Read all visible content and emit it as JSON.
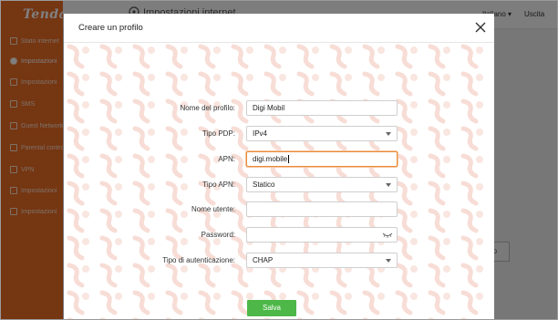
{
  "app": {
    "brand": "Tenda",
    "topbar_title": "Impostazioni internet",
    "language": "Italiano",
    "logout": "Uscita",
    "sidebar": [
      {
        "label": "Stato internet",
        "icon": "globe-icon"
      },
      {
        "label": "Impostazioni",
        "icon": "settings-icon",
        "active": true
      },
      {
        "label": "Impostazioni",
        "icon": "wifi-icon"
      },
      {
        "label": "SMS",
        "icon": "sms-icon"
      },
      {
        "label": "Guest Network",
        "icon": "guest-icon"
      },
      {
        "label": "Parental control",
        "icon": "parental-icon"
      },
      {
        "label": "VPN",
        "icon": "vpn-icon"
      },
      {
        "label": "Impostazioni",
        "icon": "advanced-icon"
      },
      {
        "label": "Impostazioni",
        "icon": "system-icon"
      }
    ],
    "background_button": "lo"
  },
  "modal": {
    "title": "Creare un profilo",
    "fields": {
      "profile_name": {
        "label": "Nome del profilo:",
        "value": "Digi Mobil"
      },
      "pdp_type": {
        "label": "Tipo PDP:",
        "value": "IPv4"
      },
      "apn": {
        "label": "APN:",
        "value": "digi.mobile"
      },
      "apn_type": {
        "label": "Tipo APN:",
        "value": "Statico"
      },
      "username": {
        "label": "Nome utente:",
        "value": ""
      },
      "password": {
        "label": "Password:",
        "value": ""
      },
      "auth_type": {
        "label": "Tipo di autenticazione:",
        "value": "CHAP"
      }
    },
    "save_label": "Salva"
  },
  "colors": {
    "brand_orange": "#ea6c24",
    "focus_border": "#e98b3a",
    "save_green": "#4db848"
  }
}
